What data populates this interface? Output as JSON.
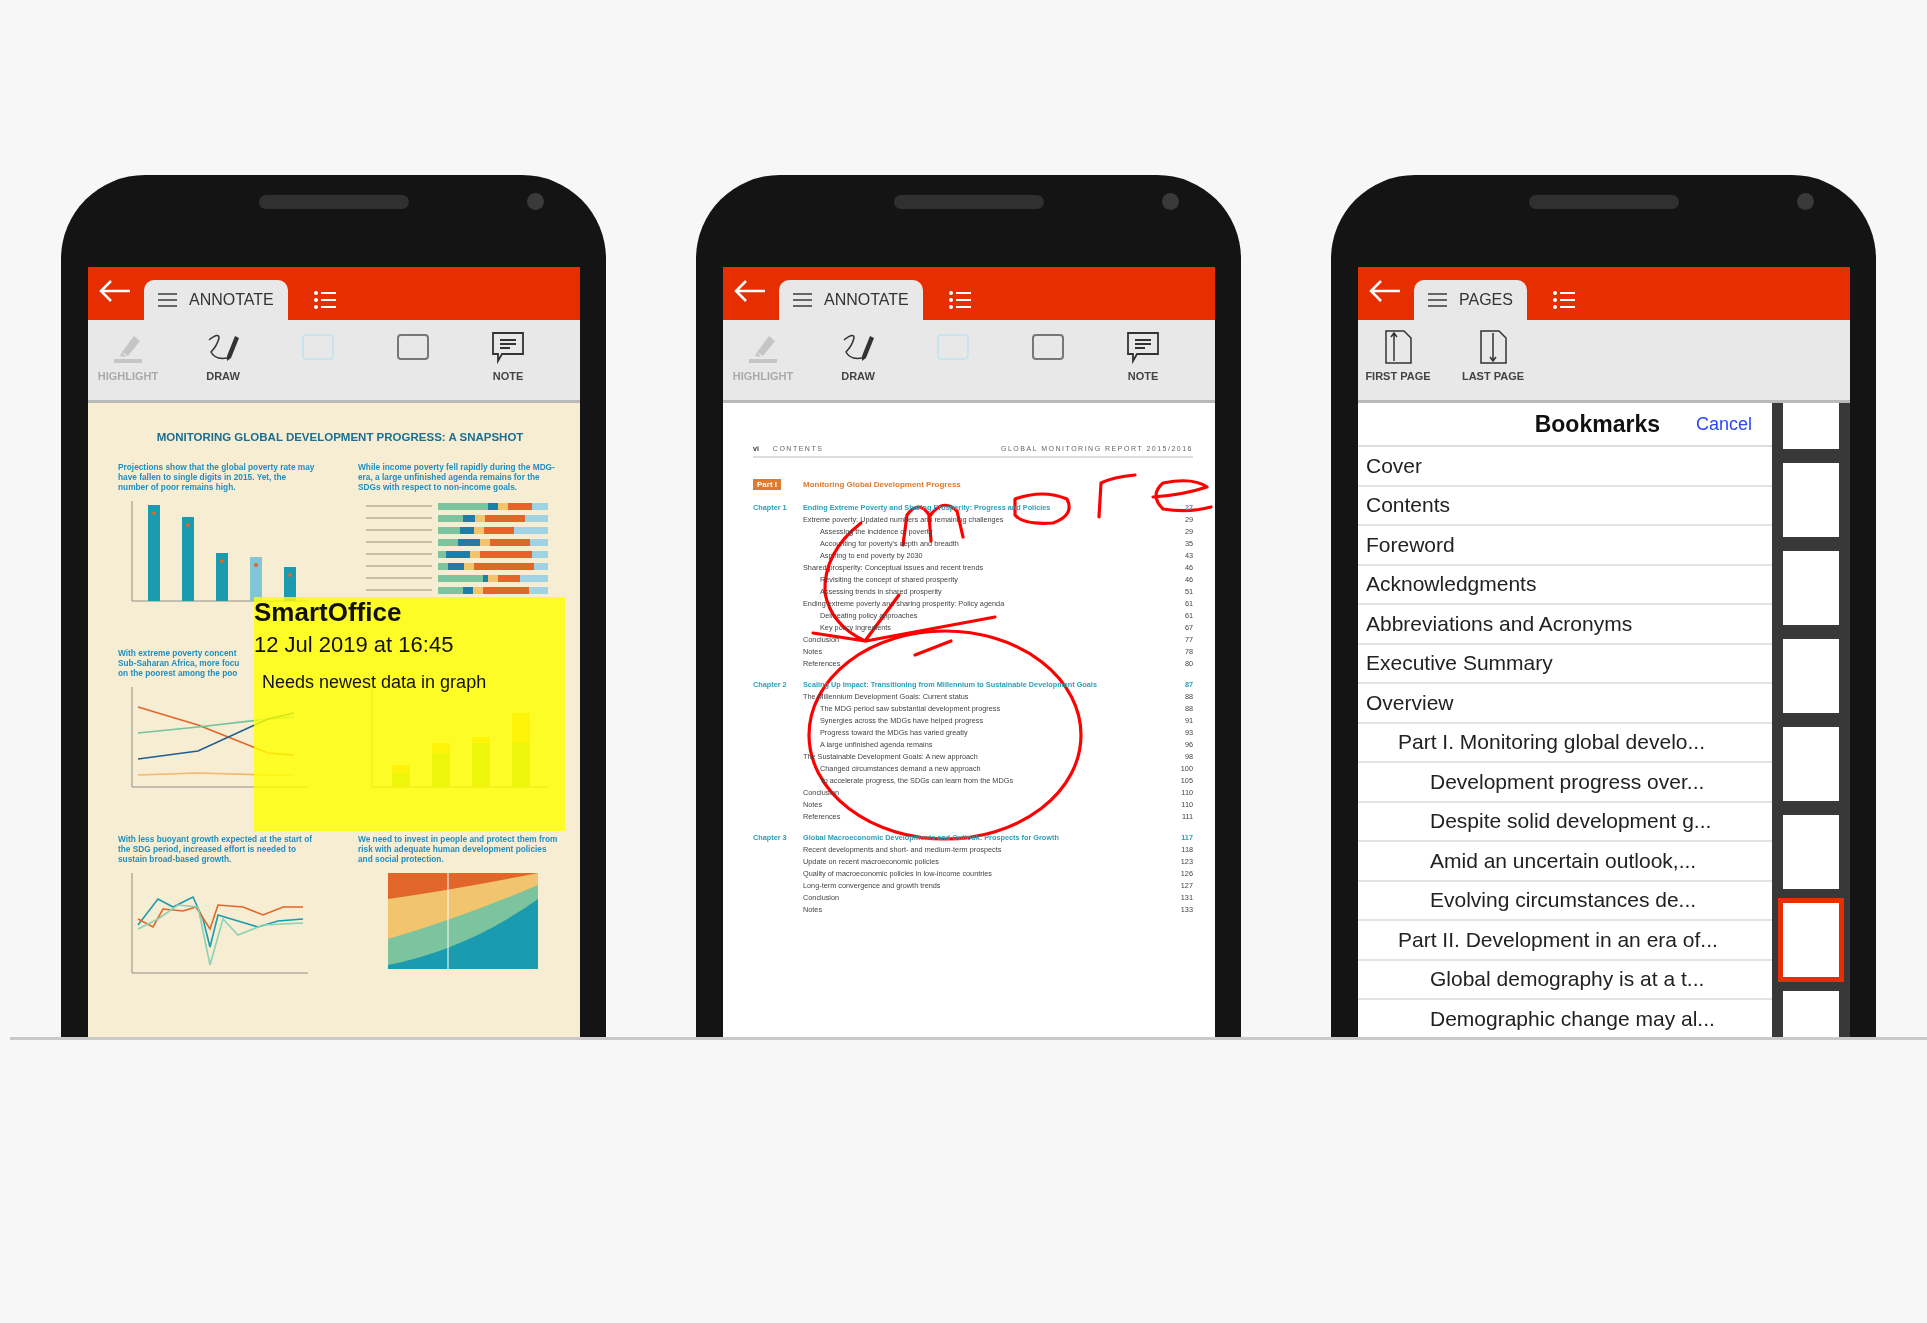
{
  "phones": [
    {
      "kind": "annotate",
      "tabs": [
        {
          "label": "ANNOTATE",
          "selected": true
        },
        {
          "selected": false
        }
      ],
      "tools": [
        {
          "kind": "highlight",
          "label": "HIGHLIGHT",
          "disabled": true
        },
        {
          "kind": "draw",
          "label": "DRAW",
          "disabled": false
        },
        {
          "kind": "swatch",
          "disabled": false
        },
        {
          "kind": "square",
          "disabled": false
        },
        {
          "kind": "note",
          "label": "NOTE",
          "disabled": false
        }
      ],
      "document": {
        "kind": "snapshot",
        "title": "MONITORING GLOBAL DEVELOPMENT PROGRESS: A SNAPSHOT",
        "panels": [
          {
            "kind": "bars",
            "heading": [
              "Projections show that the global poverty rate may have fallen to single digits in 2015. Yet, the number of poor remains high."
            ]
          },
          {
            "kind": "hbars",
            "heading": [
              "While income poverty fell rapidly during the MDG-era, a large unfinished agenda remains for the SDGs with respect to non-income goals."
            ]
          },
          {
            "kind": "lines",
            "heading": [
              "With extreme poverty concent",
              "Sub-Saharan Africa, more focu",
              "on the poorest among the poo"
            ]
          },
          {
            "kind": "stacked"
          },
          {
            "kind": "growth",
            "heading": [
              "With less buoyant growth expected at the start of the SDG period, increased effort is needed to sustain broad-based growth."
            ]
          },
          {
            "kind": "area",
            "heading": [
              "We need to invest in people and protect them from risk with adequate human development policies and social protection."
            ]
          }
        ]
      },
      "note": {
        "author": "SmartOffice",
        "date": "12 Jul 2019 at 16:45",
        "text": "Needs newest data in graph"
      }
    },
    {
      "kind": "annotate",
      "tabs": [
        {
          "label": "ANNOTATE",
          "selected": true
        },
        {
          "selected": false
        }
      ],
      "tools": [
        {
          "kind": "highlight",
          "label": "HIGHLIGHT",
          "disabled": true
        },
        {
          "kind": "draw",
          "label": "DRAW",
          "disabled": false
        },
        {
          "kind": "swatch",
          "disabled": false
        },
        {
          "kind": "square",
          "disabled": false
        },
        {
          "kind": "note",
          "label": "NOTE",
          "disabled": false
        }
      ],
      "document": {
        "kind": "contents",
        "page_number": "vi",
        "section": "CONTENTS",
        "running_title": "GLOBAL MONITORING REPORT 2015/2016",
        "part": {
          "label": "Part I",
          "title": "Monitoring Global Development Progress"
        },
        "chapters": [
          {
            "label": "Chapter 1",
            "title": "Ending Extreme Poverty and Sharing Prosperity: Progress and Policies",
            "page": "27",
            "entries": [
              {
                "title": "Extreme poverty: Updated numbers and remaining challenges",
                "page": "29",
                "children": [
                  {
                    "title": "Assessing the incidence of poverty",
                    "page": "29"
                  },
                  {
                    "title": "Accounting for poverty's depth and breadth",
                    "page": "35"
                  },
                  {
                    "title": "Aspiring to end poverty by 2030",
                    "page": "43"
                  }
                ]
              },
              {
                "title": "Shared prosperity: Conceptual issues and recent trends",
                "page": "46",
                "children": [
                  {
                    "title": "Revisiting the concept of shared prosperity",
                    "page": "46"
                  },
                  {
                    "title": "Assessing trends in shared prosperity",
                    "page": "51"
                  }
                ]
              },
              {
                "title": "Ending extreme poverty and sharing prosperity: Policy agenda",
                "page": "61",
                "children": [
                  {
                    "title": "Delineating policy approaches",
                    "page": "61"
                  },
                  {
                    "title": "Key policy ingredients",
                    "page": "67"
                  }
                ]
              },
              {
                "title": "Conclusion",
                "page": "77"
              },
              {
                "title": "Notes",
                "page": "78"
              },
              {
                "title": "References",
                "page": "80"
              }
            ]
          },
          {
            "label": "Chapter 2",
            "title": "Scaling Up Impact: Transitioning from Millennium to Sustainable Development Goals",
            "page": "87",
            "entries": [
              {
                "title": "The Millennium Development Goals: Current status",
                "page": "88",
                "children": [
                  {
                    "title": "The MDG period saw substantial development progress",
                    "page": "88"
                  },
                  {
                    "title": "Synergies across the MDGs have helped progress",
                    "page": "91"
                  },
                  {
                    "title": "Progress toward the MDGs has varied greatly",
                    "page": "93"
                  },
                  {
                    "title": "A large unfinished agenda remains",
                    "page": "96"
                  }
                ]
              },
              {
                "title": "The Sustainable Development Goals: A new approach",
                "page": "98",
                "children": [
                  {
                    "title": "Changed circumstances demand a new approach",
                    "page": "100"
                  },
                  {
                    "title": "To accelerate progress, the SDGs can learn from the MDGs",
                    "page": "105"
                  }
                ]
              },
              {
                "title": "Conclusion",
                "page": "110"
              },
              {
                "title": "Notes",
                "page": "110"
              },
              {
                "title": "References",
                "page": "111"
              }
            ]
          },
          {
            "label": "Chapter 3",
            "title": "Global Macroeconomic Developments and Outlook: Prospects for Growth",
            "page": "117",
            "entries": [
              {
                "title": "Recent developments and short- and medium-term prospects",
                "page": "118"
              },
              {
                "title": "Update on recent macroeconomic policies",
                "page": "123"
              },
              {
                "title": "Quality of macroeconomic policies in low-income countries",
                "page": "126"
              },
              {
                "title": "Long-term convergence and growth trends",
                "page": "127"
              },
              {
                "title": "Conclusion",
                "page": "131"
              },
              {
                "title": "Notes",
                "page": "133"
              }
            ]
          }
        ]
      }
    },
    {
      "kind": "pages",
      "tabs": [
        {
          "label": "PAGES",
          "selected": true
        },
        {
          "selected": false
        }
      ],
      "tools": [
        {
          "kind": "first-page",
          "label": "FIRST PAGE",
          "disabled": false
        },
        {
          "kind": "last-page",
          "label": "LAST PAGE",
          "disabled": false
        }
      ],
      "bookmarks": {
        "title": "Bookmarks",
        "cancel": "Cancel",
        "items": [
          {
            "title": "Cover"
          },
          {
            "title": "Contents"
          },
          {
            "title": "Foreword"
          },
          {
            "title": "Acknowledgments"
          },
          {
            "title": "Abbreviations and Acronyms"
          },
          {
            "title": "Executive Summary"
          },
          {
            "title": "Overview",
            "children": [
              {
                "title": "Part I. Monitoring global develo...",
                "children": [
                  {
                    "title": "Development progress over..."
                  },
                  {
                    "title": "Despite solid development g..."
                  },
                  {
                    "title": "Amid an uncertain outlook,..."
                  },
                  {
                    "title": "Evolving circumstances de..."
                  }
                ]
              },
              {
                "title": "Part II. Development in an era of...",
                "children": [
                  {
                    "title": "Global demography is at a t..."
                  },
                  {
                    "title": "Demographic change may al..."
                  }
                ]
              }
            ]
          }
        ]
      },
      "thumbnails": [
        {
          "selected": false
        },
        {
          "selected": false
        },
        {
          "selected": false
        },
        {
          "selected": false
        },
        {
          "selected": false
        },
        {
          "selected": false
        },
        {
          "selected": true
        },
        {
          "selected": false
        }
      ]
    }
  ]
}
